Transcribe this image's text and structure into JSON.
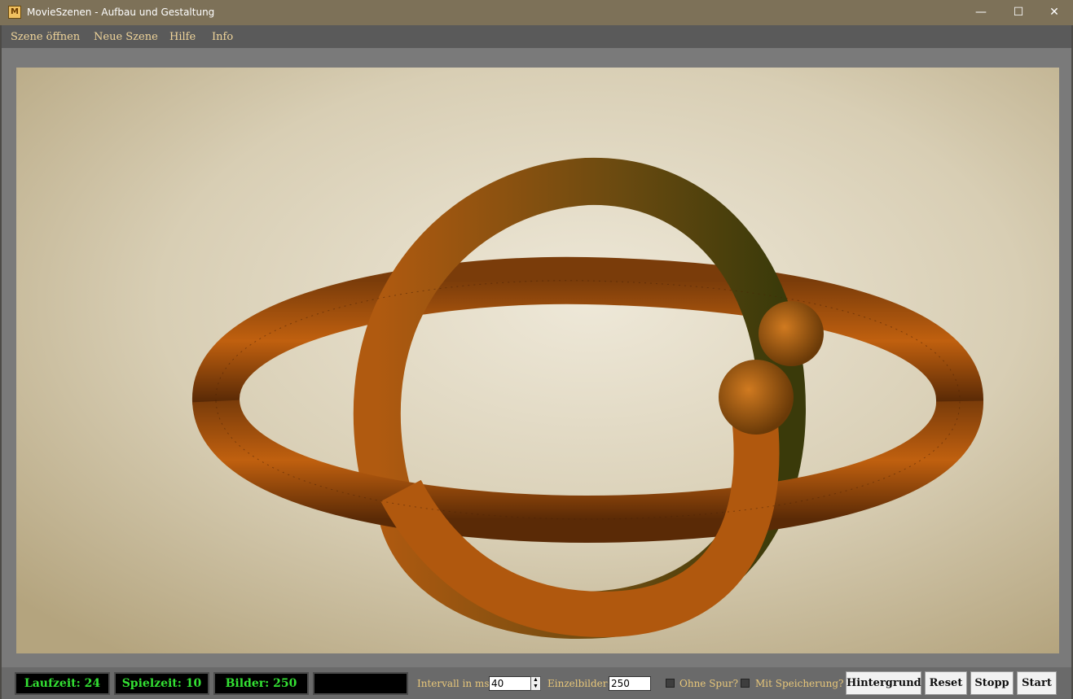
{
  "window": {
    "title": "MovieSzenen - Aufbau und Gestaltung",
    "icon": "app-logo-icon",
    "controls": {
      "minimize": "—",
      "maximize": "☐",
      "close": "✕"
    }
  },
  "menu": {
    "items": [
      "Szene öffnen",
      "Neue Szene",
      "Hilfe",
      "Info"
    ]
  },
  "scene": {
    "description_icon": "torus-knot-render",
    "background_color": "#d9cfb6",
    "tube_color": "#b85a10"
  },
  "status": {
    "laufzeit": "Laufzeit: 24",
    "spielzeit": "Spielzeit: 10",
    "bilder": "Bilder: 250",
    "empty_display": ""
  },
  "controls": {
    "intervall_label": "Intervall in ms:",
    "intervall_value": "40",
    "einzelbilder_label": "Einzelbilder:",
    "einzelbilder_value": "250",
    "ohne_spur_label": "Ohne Spur?",
    "ohne_spur_checked": false,
    "mit_speicherung_label": "Mit Speicherung?",
    "mit_speicherung_checked": false,
    "buttons": {
      "hintergrund": "Hintergrund",
      "reset": "Reset",
      "stopp": "Stopp",
      "start": "Start"
    }
  },
  "colors": {
    "titlebar": "#7d7158",
    "menu_text": "#f0d59a",
    "counter_text": "#33e033",
    "label_text": "#e8c77a"
  }
}
